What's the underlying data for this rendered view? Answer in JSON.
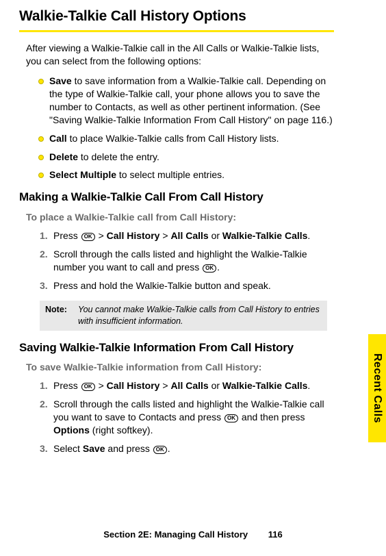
{
  "title": "Walkie-Talkie Call History Options",
  "intro": "After viewing a Walkie-Talkie call in the All Calls or Walkie-Talkie lists, you can select from the following options:",
  "bullets": [
    {
      "term": "Save",
      "rest": " to save information from a Walkie-Talkie call. Depending on the type of Walkie-Talkie call, your phone allows you to save the number to Contacts, as well as other pertinent information. (See \"Saving Walkie-Talkie Information From Call History\" on page 116.)"
    },
    {
      "term": "Call",
      "rest": " to place Walkie-Talkie calls from Call History lists."
    },
    {
      "term": "Delete",
      "rest": " to delete the entry."
    },
    {
      "term": "Select Multiple",
      "rest": " to select multiple entries."
    }
  ],
  "section1": {
    "heading": "Making a Walkie-Talkie Call From Call History",
    "lead": "To place a Walkie-Talkie call from Call History:",
    "steps": [
      {
        "n": "1.",
        "pre": "Press ",
        "ok": "OK",
        "post1": " > ",
        "b1": "Call History",
        "post2": " > ",
        "b2": "All Calls",
        "post3": " or ",
        "b3": "Walkie-Talkie Calls",
        "post4": "."
      },
      {
        "n": "2.",
        "text": "Scroll through the calls listed and highlight the Walkie-Talkie number you want to call and press ",
        "ok": "OK",
        "post": "."
      },
      {
        "n": "3.",
        "text": "Press and hold the Walkie-Talkie button and speak."
      }
    ],
    "noteLabel": "Note:",
    "noteBody": "You cannot make Walkie-Talkie calls from Call History to entries with insufficient information."
  },
  "section2": {
    "heading": "Saving Walkie-Talkie Information From Call History",
    "lead": "To save Walkie-Talkie information from Call History:",
    "steps": [
      {
        "n": "1.",
        "pre": "Press ",
        "ok": "OK",
        "post1": " > ",
        "b1": "Call History",
        "post2": " > ",
        "b2": "All Calls",
        "post3": " or ",
        "b3": "Walkie-Talkie Calls",
        "post4": "."
      },
      {
        "n": "2.",
        "text_a": "Scroll through the calls listed and highlight the Walkie-Talkie call you want to save to Contacts and press ",
        "ok1": "OK",
        "text_b": " and then press ",
        "b1": "Options",
        "text_c": " (right softkey)."
      },
      {
        "n": "3.",
        "text_a": "Select ",
        "b1": "Save",
        "text_b": " and press ",
        "ok1": "OK",
        "text_c": "."
      }
    ]
  },
  "sideTab": "Recent Calls",
  "footer": {
    "section": "Section 2E: Managing Call History",
    "page": "116"
  },
  "okGlyph": "OK"
}
